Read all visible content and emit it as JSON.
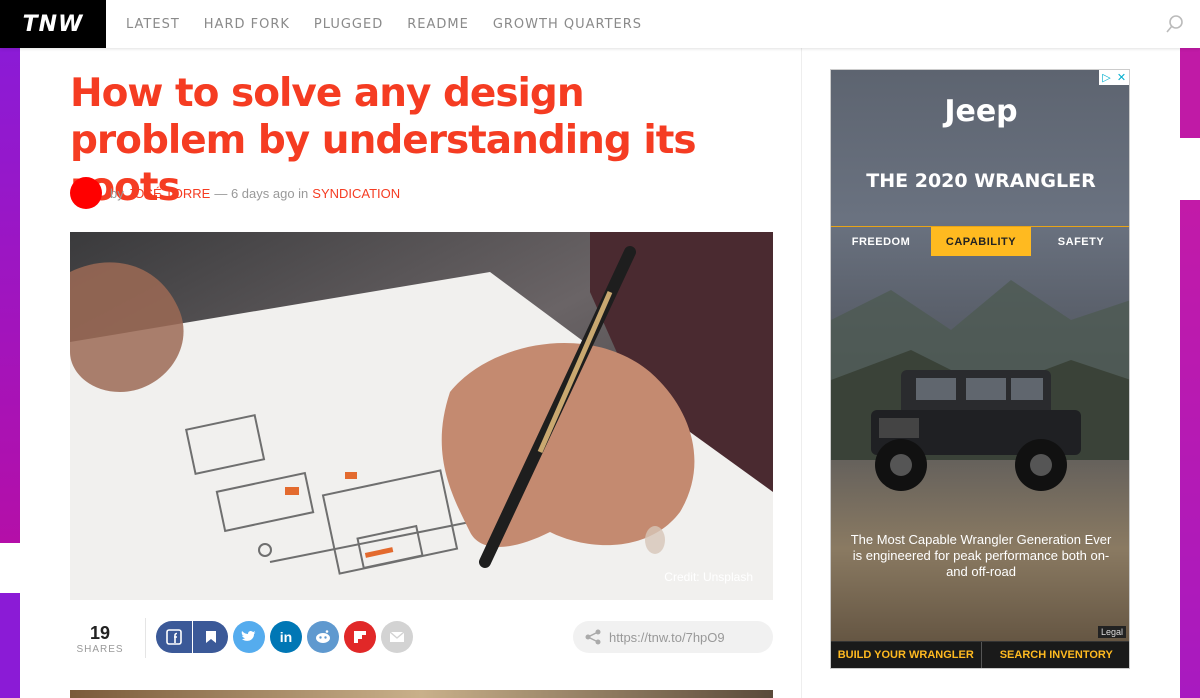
{
  "site": {
    "logo": "TNW"
  },
  "nav": {
    "items": [
      "LATEST",
      "HARD FORK",
      "PLUGGED",
      "README",
      "GROWTH QUARTERS"
    ]
  },
  "article": {
    "title": "How to solve any design problem by understanding its roots",
    "byline_prefix": "by",
    "author": "JOSÉ TORRE",
    "date_text": "— 6 days ago in",
    "category": "SYNDICATION",
    "image_credit": "Credit: Unsplash"
  },
  "shares": {
    "count": "19",
    "label": "SHARES",
    "short_url": "https://tnw.to/7hpO9"
  },
  "ad": {
    "brand": "Jeep",
    "headline": "THE 2020 WRANGLER",
    "tabs": [
      "FREEDOM",
      "CAPABILITY",
      "SAFETY"
    ],
    "body": "The Most Capable Wrangler Generation Ever is engineered for peak performance both on- and off-road",
    "legal": "Legal",
    "cta_left": "BUILD YOUR WRANGLER",
    "cta_right": "SEARCH INVENTORY"
  },
  "colors": {
    "accent": "#f53c22",
    "side_bar": "#8b1bd6",
    "ad_yellow": "#ffba20"
  }
}
